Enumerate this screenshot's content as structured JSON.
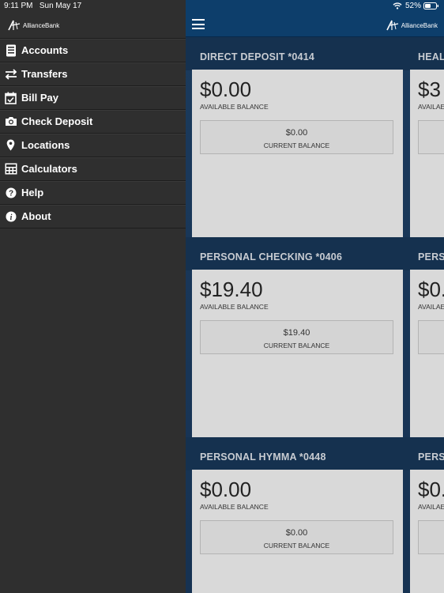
{
  "status": {
    "time": "9:11 PM",
    "date": "Sun May 17",
    "battery": "52%"
  },
  "brand": {
    "name": "AllianceBank"
  },
  "colors": {
    "drawer_bg": "#2f2f2f",
    "topbar_bg": "#0d3e6b",
    "card_bg": "#d9d9d9",
    "page_bg": "#1c3c60"
  },
  "menu": [
    {
      "label": "Accounts",
      "icon": "accounts-icon"
    },
    {
      "label": "Transfers",
      "icon": "transfers-icon"
    },
    {
      "label": "Bill Pay",
      "icon": "calendar-icon"
    },
    {
      "label": "Check Deposit",
      "icon": "camera-icon"
    },
    {
      "label": "Locations",
      "icon": "location-pin-icon"
    },
    {
      "label": "Calculators",
      "icon": "calculator-icon"
    },
    {
      "label": "Help",
      "icon": "help-icon"
    },
    {
      "label": "About",
      "icon": "info-icon"
    }
  ],
  "accounts": [
    {
      "title": "DIRECT DEPOSIT *0414",
      "available": "$0.00",
      "available_label": "AVAILABLE BALANCE",
      "current": "$0.00",
      "current_label": "CURRENT BALANCE"
    },
    {
      "title": "PERSONAL CHECKING *0406",
      "available": "$19.40",
      "available_label": "AVAILABLE BALANCE",
      "current": "$19.40",
      "current_label": "CURRENT BALANCE"
    },
    {
      "title": "PERSONAL HYMMA *0448",
      "available": "$0.00",
      "available_label": "AVAILABLE BALANCE",
      "current": "$0.00",
      "current_label": "CURRENT BALANCE"
    }
  ],
  "partial_accounts": [
    {
      "title": "HEAL",
      "available": "$3",
      "available_label": "AVAILAE"
    },
    {
      "title": "PERS",
      "available": "$0.",
      "available_label": "AVAILAE"
    },
    {
      "title": "PERS",
      "available": "$0.",
      "available_label": "AVAILAE"
    }
  ]
}
